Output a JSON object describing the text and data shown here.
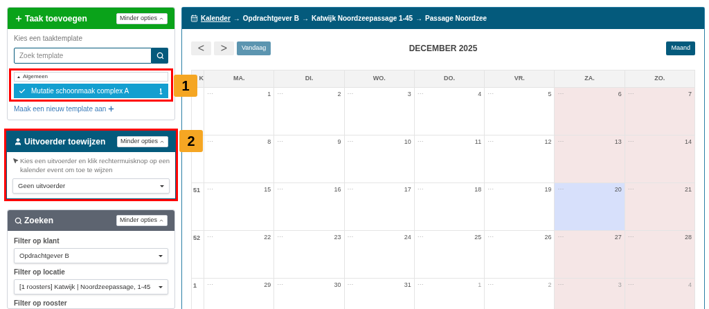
{
  "task_panel": {
    "title": "Taak toevoegen",
    "toggle": "Minder opties",
    "prompt": "Kies een taaktemplate",
    "search": {
      "placeholder": "Zoek template"
    },
    "group": {
      "label": "Algemeen",
      "expanded": true,
      "items": [
        {
          "label": "Mutatie schoonmaak complex A",
          "selected": true
        }
      ]
    },
    "new_link": "Maak een nieuw template aan",
    "callout": "1"
  },
  "assign_panel": {
    "title": "Uitvoerder toewijzen",
    "toggle": "Minder opties",
    "hint": "Kies een uitvoerder en klik rechtermuisknop op een kalender event om toe te wijzen",
    "select": "Geen uitvoerder",
    "callout": "2"
  },
  "search_panel": {
    "title": "Zoeken",
    "toggle": "Minder opties",
    "filters": [
      {
        "label": "Filter op klant",
        "value": "Opdrachtgever B"
      },
      {
        "label": "Filter op locatie",
        "value": "[1 roosters] Katwijk | Noordzeepassage, 1-45"
      },
      {
        "label": "Filter op rooster"
      }
    ]
  },
  "calendar": {
    "breadcrumb": [
      {
        "label": "Kalender",
        "link": true
      },
      {
        "label": "→",
        "link": false
      },
      {
        "label": "Opdrachtgever B",
        "link": false
      },
      {
        "label": "→",
        "link": false
      },
      {
        "label": "Katwijk Noordzeepassage 1-45",
        "link": false
      },
      {
        "label": "→",
        "link": false
      },
      {
        "label": "Passage Noordzee",
        "link": false
      }
    ],
    "prev": "<",
    "next": ">",
    "today_button": "Vandaag",
    "title": "DECEMBER 2025",
    "view_button": "Maand",
    "week_header": "K",
    "columns": [
      {
        "label": "MA.",
        "weekend": false
      },
      {
        "label": "DI.",
        "weekend": false
      },
      {
        "label": "WO.",
        "weekend": false
      },
      {
        "label": "DO.",
        "weekend": false
      },
      {
        "label": "VR.",
        "weekend": false
      },
      {
        "label": "ZA.",
        "weekend": true
      },
      {
        "label": "ZO.",
        "weekend": true
      }
    ],
    "weeks": [
      {
        "days": [
          {
            "day": "1",
            "marker": "···",
            "outside": false,
            "today": false
          },
          {
            "day": "2",
            "marker": "···",
            "outside": false,
            "today": false
          },
          {
            "day": "3",
            "marker": "···",
            "outside": false,
            "today": false
          },
          {
            "day": "4",
            "marker": "···",
            "outside": false,
            "today": false
          },
          {
            "day": "5",
            "marker": "···",
            "outside": false,
            "today": false
          },
          {
            "day": "6",
            "marker": "···",
            "outside": false,
            "today": false
          },
          {
            "day": "7",
            "marker": "···",
            "outside": false,
            "today": false
          }
        ]
      },
      {
        "days": [
          {
            "day": "8",
            "marker": "···",
            "outside": false,
            "today": false
          },
          {
            "day": "9",
            "marker": "···",
            "outside": false,
            "today": false
          },
          {
            "day": "10",
            "marker": "···",
            "outside": false,
            "today": false
          },
          {
            "day": "11",
            "marker": "···",
            "outside": false,
            "today": false
          },
          {
            "day": "12",
            "marker": "···",
            "outside": false,
            "today": false
          },
          {
            "day": "13",
            "marker": "···",
            "outside": false,
            "today": false
          },
          {
            "day": "14",
            "marker": "···",
            "outside": false,
            "today": false
          }
        ]
      },
      {
        "week": "51",
        "days": [
          {
            "day": "15",
            "marker": "···",
            "outside": false,
            "today": false
          },
          {
            "day": "16",
            "marker": "···",
            "outside": false,
            "today": false
          },
          {
            "day": "17",
            "marker": "···",
            "outside": false,
            "today": false
          },
          {
            "day": "18",
            "marker": "···",
            "outside": false,
            "today": false
          },
          {
            "day": "19",
            "marker": "···",
            "outside": false,
            "today": false
          },
          {
            "day": "20",
            "marker": "···",
            "outside": false,
            "today": true
          },
          {
            "day": "21",
            "marker": "···",
            "outside": false,
            "today": false
          }
        ]
      },
      {
        "week": "52",
        "days": [
          {
            "day": "22",
            "marker": "···",
            "outside": false,
            "today": false
          },
          {
            "day": "23",
            "marker": "···",
            "outside": false,
            "today": false
          },
          {
            "day": "24",
            "marker": "···",
            "outside": false,
            "today": false
          },
          {
            "day": "25",
            "marker": "···",
            "outside": false,
            "today": false
          },
          {
            "day": "26",
            "marker": "···",
            "outside": false,
            "today": false
          },
          {
            "day": "27",
            "marker": "···",
            "outside": false,
            "today": false
          },
          {
            "day": "28",
            "marker": "···",
            "outside": false,
            "today": false
          }
        ]
      },
      {
        "week": "1",
        "days": [
          {
            "day": "29",
            "marker": "···",
            "outside": false,
            "today": false
          },
          {
            "day": "30",
            "marker": "···",
            "outside": false,
            "today": false
          },
          {
            "day": "31",
            "marker": "···",
            "outside": false,
            "today": false
          },
          {
            "day": "1",
            "marker": "···",
            "outside": true,
            "today": false
          },
          {
            "day": "2",
            "marker": "···",
            "outside": true,
            "today": false
          },
          {
            "day": "3",
            "marker": "···",
            "outside": true,
            "today": false
          },
          {
            "day": "4",
            "marker": "···",
            "outside": true,
            "today": false
          }
        ]
      }
    ]
  }
}
